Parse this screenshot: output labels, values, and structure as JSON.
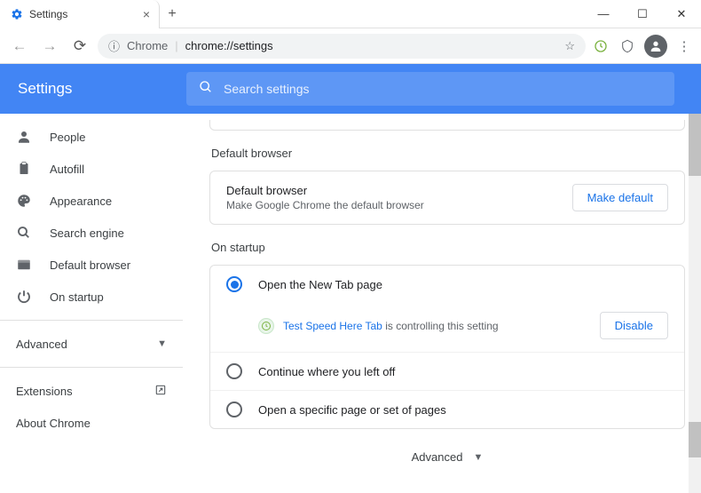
{
  "window": {
    "tab_title": "Settings",
    "minimize": "—",
    "maximize": "☐",
    "close": "✕"
  },
  "addr": {
    "chrome_label": "Chrome",
    "url": "chrome://settings"
  },
  "header": {
    "title": "Settings",
    "search_placeholder": "Search settings"
  },
  "sidebar": {
    "items": [
      {
        "icon": "person",
        "label": "People"
      },
      {
        "icon": "clipboard",
        "label": "Autofill"
      },
      {
        "icon": "palette",
        "label": "Appearance"
      },
      {
        "icon": "search",
        "label": "Search engine"
      },
      {
        "icon": "browser",
        "label": "Default browser"
      },
      {
        "icon": "power",
        "label": "On startup"
      }
    ],
    "advanced": "Advanced",
    "extensions": "Extensions",
    "about": "About Chrome"
  },
  "main": {
    "default_browser": {
      "title": "Default browser",
      "label": "Default browser",
      "sub": "Make Google Chrome the default browser",
      "button": "Make default"
    },
    "startup": {
      "title": "On startup",
      "opt1": "Open the New Tab page",
      "ext_name": "Test Speed Here Tab",
      "ext_suffix": " is controlling this setting",
      "disable": "Disable",
      "opt2": "Continue where you left off",
      "opt3": "Open a specific page or set of pages"
    },
    "advanced": "Advanced"
  }
}
